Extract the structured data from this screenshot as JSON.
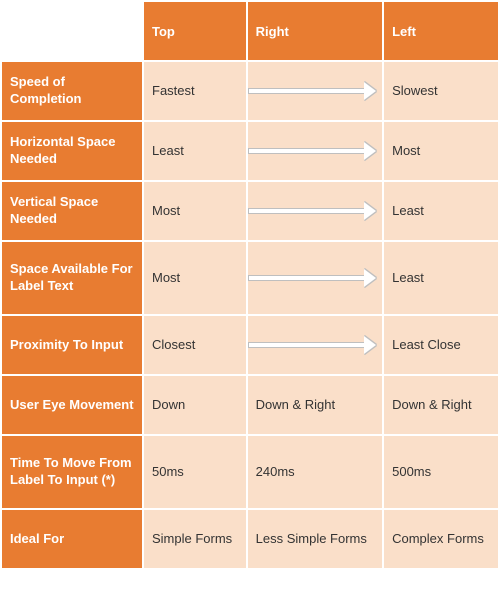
{
  "columns": {
    "c0": "",
    "c1": "Top",
    "c2": "Right",
    "c3": "Left"
  },
  "rows": [
    {
      "label": "Speed of Completion",
      "top": "Fastest",
      "right": "",
      "left": "Slowest",
      "arrow": true
    },
    {
      "label": "Horizontal Space Needed",
      "top": "Least",
      "right": "",
      "left": "Most",
      "arrow": true
    },
    {
      "label": "Vertical Space Needed",
      "top": "Most",
      "right": "",
      "left": "Least",
      "arrow": true
    },
    {
      "label": "Space Available For Label Text",
      "top": "Most",
      "right": "",
      "left": "Least",
      "arrow": true
    },
    {
      "label": "Proximity To Input",
      "top": "Closest",
      "right": "",
      "left": "Least Close",
      "arrow": true
    },
    {
      "label": "User Eye Movement",
      "top": "Down",
      "right": "Down & Right",
      "left": "Down & Right",
      "arrow": false
    },
    {
      "label": "Time To Move From Label To Input (*)",
      "top": "50ms",
      "right": "240ms",
      "left": "500ms",
      "arrow": false
    },
    {
      "label": "Ideal For",
      "top": "Simple Forms",
      "right": "Less Simple Forms",
      "left": "Complex Forms",
      "arrow": false
    }
  ]
}
